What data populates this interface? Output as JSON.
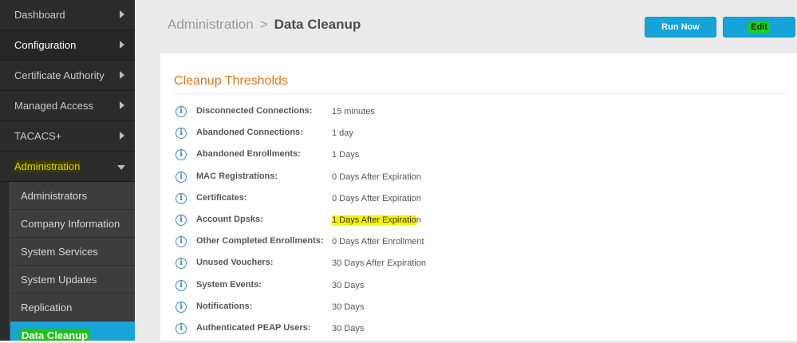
{
  "sidebar": {
    "items": [
      {
        "label": "Dashboard"
      },
      {
        "label": "Configuration"
      },
      {
        "label": "Certificate Authority"
      },
      {
        "label": "Managed Access"
      },
      {
        "label": "TACACS+"
      },
      {
        "label": "Administration"
      }
    ],
    "subitems": [
      {
        "label": "Administrators"
      },
      {
        "label": "Company Information"
      },
      {
        "label": "System Services"
      },
      {
        "label": "System Updates"
      },
      {
        "label": "Replication"
      },
      {
        "label": "Data Cleanup"
      }
    ]
  },
  "header": {
    "breadcrumb_parent": "Administration",
    "breadcrumb_sep": ">",
    "breadcrumb_current": "Data Cleanup"
  },
  "toolbar": {
    "run_label": "Run Now",
    "edit_label": "Edit"
  },
  "panel": {
    "title": "Cleanup Thresholds",
    "rows": [
      {
        "label": "Disconnected Connections:",
        "value": "15 minutes"
      },
      {
        "label": "Abandoned Connections:",
        "value": "1 day"
      },
      {
        "label": "Abandoned Enrollments:",
        "value": "1 Days"
      },
      {
        "label": "MAC Registrations:",
        "value": "0 Days After Expiration"
      },
      {
        "label": "Certificates:",
        "value": "0 Days After Expiration"
      },
      {
        "label": "Account Dpsks:",
        "value_highlight": "1 Days After Expiratio",
        "value_rest": "n"
      },
      {
        "label": "Other Completed Enrollments:",
        "value": "0 Days After Enrollment"
      },
      {
        "label": "Unused Vouchers:",
        "value": "30 Days After Expiration"
      },
      {
        "label": "System Events:",
        "value": "30 Days"
      },
      {
        "label": "Notifications:",
        "value": "30 Days"
      },
      {
        "label": "Authenticated PEAP Users:",
        "value": "30 Days"
      }
    ]
  },
  "colors": {
    "accent": "#14a4da",
    "title_orange": "#d9781c",
    "highlight_yellow": "#f4f400",
    "highlight_green": "#21c21a"
  },
  "icons": {
    "info": "info-icon"
  }
}
